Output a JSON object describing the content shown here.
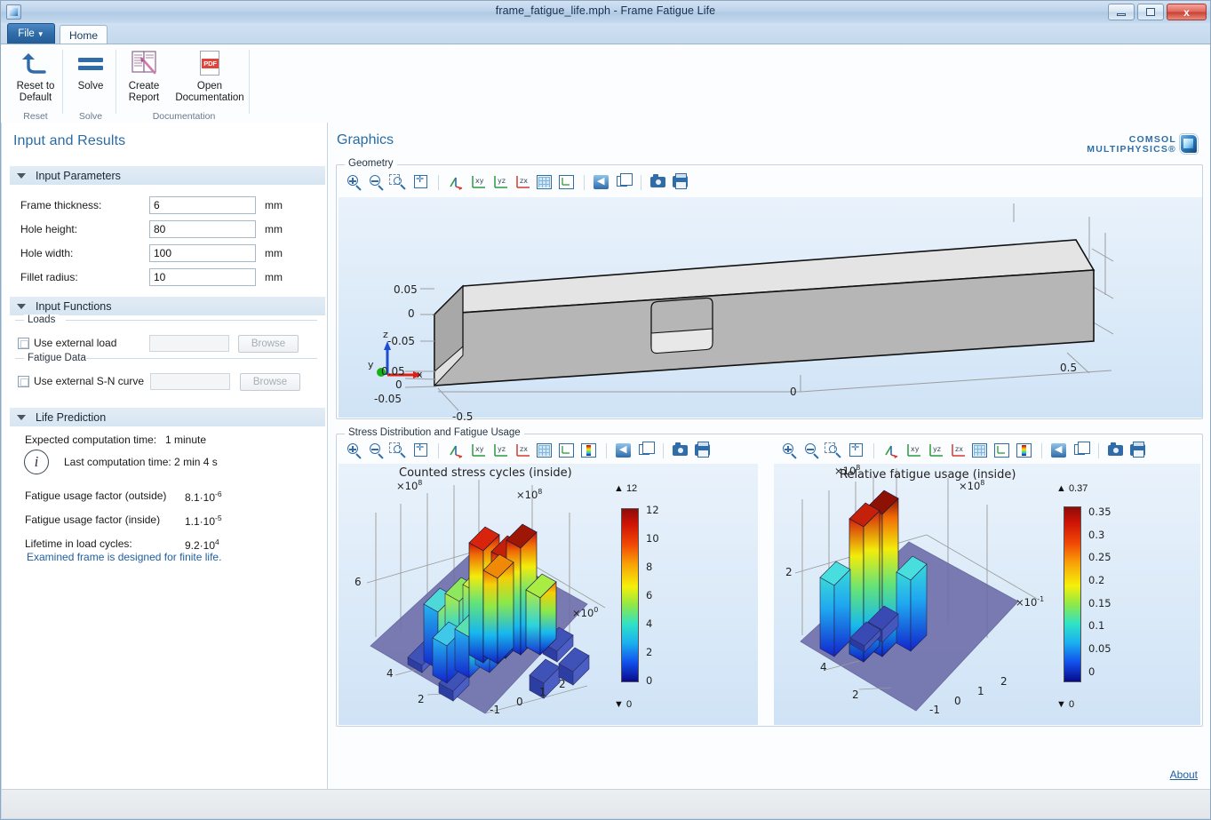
{
  "window": {
    "title": "frame_fatigue_life.mph - Frame Fatigue Life",
    "minimize_label": "Minimize",
    "maximize_label": "Maximize",
    "close_label": "x"
  },
  "ribbon": {
    "file_tab": "File",
    "file_caret": "▼",
    "home_tab": "Home",
    "groups": [
      {
        "caption": "Reset",
        "buttons": [
          {
            "label": "Reset to\nDefault",
            "icon": "undo-arrow-icon"
          }
        ]
      },
      {
        "caption": "Solve",
        "buttons": [
          {
            "label": "Solve",
            "icon": "equals-icon"
          }
        ]
      },
      {
        "caption": "Documentation",
        "buttons": [
          {
            "label": "Create\nReport",
            "icon": "create-report-icon"
          },
          {
            "label": "Open\nDocumentation",
            "icon": "pdf-icon",
            "badge": "PDF"
          }
        ]
      }
    ]
  },
  "sidebar": {
    "title": "Input and Results",
    "sections": [
      {
        "id": "input-parameters",
        "label": "Input Parameters",
        "expanded": true
      },
      {
        "id": "input-functions",
        "label": "Input Functions",
        "expanded": true
      },
      {
        "id": "life-prediction",
        "label": "Life Prediction",
        "expanded": true
      }
    ],
    "parameters": [
      {
        "label": "Frame thickness:",
        "value": "6",
        "unit": "mm"
      },
      {
        "label": "Hole height:",
        "value": "80",
        "unit": "mm"
      },
      {
        "label": "Hole width:",
        "value": "100",
        "unit": "mm"
      },
      {
        "label": "Fillet radius:",
        "value": "10",
        "unit": "mm"
      }
    ],
    "input_functions": {
      "loads_group": "Loads",
      "fatigue_group": "Fatigue Data",
      "external_load": {
        "label": "Use external load",
        "checked": false,
        "path_value": "",
        "browse_label": "Browse"
      },
      "external_sn": {
        "label": "Use external S-N curve",
        "checked": false,
        "path_value": "",
        "browse_label": "Browse"
      }
    },
    "life_prediction": {
      "expected_time_label": "Expected computation time:",
      "expected_time_value": "1 minute",
      "last_time_text": "Last computation time: 2 min 4 s",
      "info_glyph": "i",
      "results": [
        {
          "label": "Fatigue usage factor (outside)",
          "mantissa": "8.1·10",
          "exponent": "-6"
        },
        {
          "label": "Fatigue usage factor (inside)",
          "mantissa": "1.1·10",
          "exponent": "-5"
        },
        {
          "label": "Lifetime in load cycles:",
          "mantissa": "9.2·10",
          "exponent": "4"
        }
      ],
      "note": "Examined frame is designed for finite life."
    }
  },
  "graphics": {
    "title": "Graphics",
    "brand_line1": "COMSOL",
    "brand_line2": "MULTIPHYSICS®",
    "about_label": "About",
    "geometry_panel": {
      "legend": "Geometry"
    },
    "results_panel": {
      "legend": "Stress Distribution and Fatigue Usage"
    },
    "toolbar_icons": [
      "zoom-in-icon",
      "zoom-out-icon",
      "zoom-box-icon",
      "zoom-extents-icon",
      "sep",
      "go-to-default-view-icon",
      "view-xy-icon",
      "view-yz-icon",
      "view-zx-icon",
      "show-grid-icon",
      "show-axis-icon",
      "sep",
      "scene-light-icon",
      "transparency-icon",
      "sep",
      "snapshot-icon",
      "print-icon"
    ],
    "results_toolbar_icons": [
      "zoom-in-icon",
      "zoom-out-icon",
      "zoom-box-icon",
      "zoom-extents-icon",
      "sep",
      "go-to-default-view-icon",
      "view-xy-icon",
      "view-yz-icon",
      "view-zx-icon",
      "show-grid-icon",
      "show-axis-icon",
      "color-legend-icon",
      "sep",
      "scene-light-icon",
      "transparency-icon",
      "sep",
      "snapshot-icon",
      "print-icon"
    ]
  },
  "chart_data": [
    {
      "type": "bar",
      "id": "geometry-3d-view",
      "title": "",
      "is_geometry": true,
      "x_ticks": [
        "-0.5",
        "0",
        "0.5"
      ],
      "y_ticks": [
        "-0.05",
        "0",
        "0.05"
      ],
      "z_ticks": [
        "-0.05",
        "0",
        "0.05"
      ],
      "axis_triad": {
        "x": "x",
        "y": "y",
        "z": "z"
      }
    },
    {
      "type": "bar",
      "id": "counted-stress-cycles",
      "title": "Counted stress cycles (inside)",
      "z_exponent_label": "×10⁸",
      "y_exponent_label": "×10⁸",
      "x_exponent_label": "×10⁰",
      "x_ticks": [
        "-1",
        "0",
        "1",
        "2"
      ],
      "y_ticks": [
        "2",
        "4",
        "6"
      ],
      "legend_max_marker": "▲ 12",
      "legend_min_marker": "▼ 0",
      "colorbar": {
        "ticks": [
          "12",
          "10",
          "8",
          "6",
          "4",
          "2",
          "0"
        ],
        "min": 0,
        "max": 12
      },
      "bars": [
        {
          "x": -1,
          "y": 1,
          "h": 1.2
        },
        {
          "x": -1,
          "y": 2,
          "h": 1.0
        },
        {
          "x": 0,
          "y": 2,
          "h": 3.5
        },
        {
          "x": 0,
          "y": 3,
          "h": 5.2
        },
        {
          "x": 0,
          "y": 4,
          "h": 6.5
        },
        {
          "x": 0,
          "y": 5,
          "h": 7.8
        },
        {
          "x": 1,
          "y": 3,
          "h": 10.8
        },
        {
          "x": 1,
          "y": 4,
          "h": 11.6
        },
        {
          "x": 1,
          "y": 5,
          "h": 9.4
        },
        {
          "x": 2,
          "y": 4,
          "h": 11.9
        },
        {
          "x": 2,
          "y": 5,
          "h": 2.0
        },
        {
          "x": 2,
          "y": 2,
          "h": 1.5
        }
      ]
    },
    {
      "type": "bar",
      "id": "relative-fatigue-usage",
      "title": "Relative fatigue usage (inside)",
      "z_exponent_label": "×10⁸",
      "y_exponent_label": "×10⁸",
      "x_exponent_label": "×10⁻¹",
      "x_ticks": [
        "-1",
        "0",
        "1",
        "2"
      ],
      "y_ticks": [
        "2",
        "4"
      ],
      "legend_max_marker": "▲ 0.37",
      "legend_min_marker": "▼ 0",
      "colorbar": {
        "ticks": [
          "0.35",
          "0.3",
          "0.25",
          "0.2",
          "0.15",
          "0.1",
          "0.05",
          "0"
        ],
        "min": 0,
        "max": 0.37
      },
      "bars": [
        {
          "x": 0,
          "y": 2,
          "h": 0.15
        },
        {
          "x": 0,
          "y": 3,
          "h": 0.17
        },
        {
          "x": 1,
          "y": 3,
          "h": 0.33
        },
        {
          "x": 1,
          "y": 4,
          "h": 0.37
        },
        {
          "x": 2,
          "y": 3,
          "h": 0.15
        },
        {
          "x": 1,
          "y": 2,
          "h": 0.03
        }
      ]
    }
  ],
  "colors": {
    "accent": "#2b6ca3",
    "titlebar_text": "#17314f",
    "link": "#1f5fa0",
    "panel_header_bg": "#e2ecf6",
    "canvas_bg": "#e9f2fb"
  }
}
